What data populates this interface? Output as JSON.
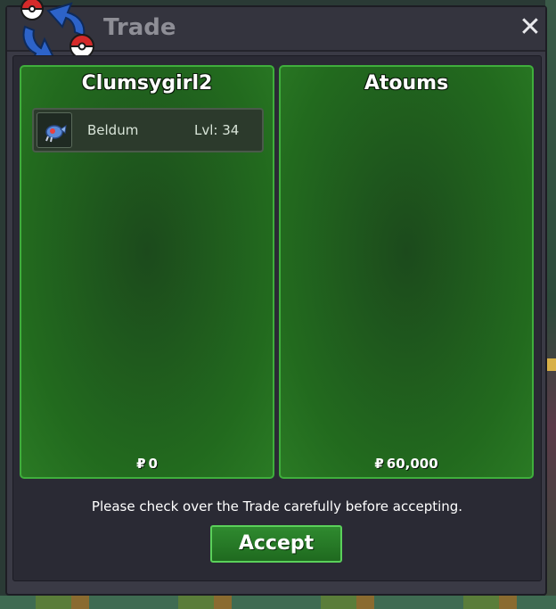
{
  "window": {
    "title": "Trade",
    "close_symbol": "✕"
  },
  "left_panel": {
    "player_name": "Clumsygirl2",
    "items": [
      {
        "icon": "beldum-icon",
        "name": "Beldum",
        "level": "Lvl: 34"
      }
    ],
    "money_symbol": "₽",
    "money": "0"
  },
  "right_panel": {
    "player_name": "Atoums",
    "items": [],
    "money_symbol": "₽",
    "money": "60,000"
  },
  "notice": "Please check over the Trade carefully before accepting.",
  "accept_label": "Accept",
  "colors": {
    "panel_green": "#226a1e",
    "panel_border": "#3fae3c",
    "window_bg": "#3a3a45",
    "accept_green": "#2f8a2f"
  }
}
